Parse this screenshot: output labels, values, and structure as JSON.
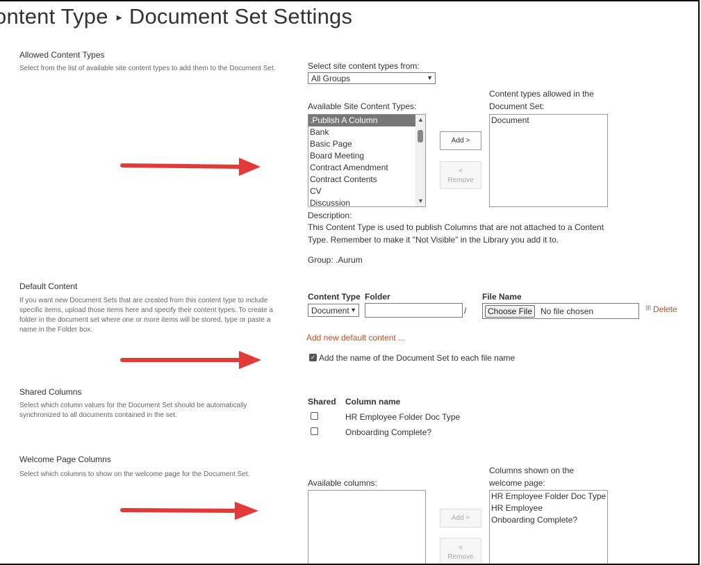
{
  "page": {
    "title_prefix": "ontent Type",
    "title_separator": "▸",
    "title_main": "Document Set Settings"
  },
  "allowed_content_types": {
    "heading": "Allowed Content Types",
    "description": "Select from the list of available site content types to add them to the Document Set.",
    "select_from_label": "Select site content types from:",
    "select_from_value": "All Groups",
    "available_label": "Available Site Content Types:",
    "available_items": [
      ".Publish A Column",
      "Bank",
      "Basic Page",
      "Board Meeting",
      "Contract Amendment",
      "Contract Contents",
      "CV",
      "Discussion"
    ],
    "selected_item": ".Publish A Column",
    "add_button": "Add >",
    "remove_button_top": "<",
    "remove_button_bottom": "Remove",
    "allowed_label": "Content types allowed in the Document Set:",
    "allowed_items": [
      "Document"
    ],
    "description_label": "Description:",
    "description_text": "This Content Type is used to publish Columns that are not attached to a Content Type. Remember to make it \"Not Visible\" in the Library you add it to.",
    "group_text": "Group: .Aurum"
  },
  "default_content": {
    "heading": "Default Content",
    "description": "If you want new Document Sets that are created from this content type to include specific items, upload those items here and specify their content types. To create a folder in the document set where one or more items will be stored, type or paste a name in the Folder box.",
    "col_content_type": "Content Type",
    "col_folder": "Folder",
    "col_file_name": "File Name",
    "content_type_value": "Document",
    "folder_value": "",
    "folder_slash": "/",
    "choose_file_button": "Choose File",
    "no_file_text": "No file chosen",
    "delete_icon": "⊞",
    "delete_link": "Delete",
    "add_new_link": "Add new default content ...",
    "add_name_checkbox_label": "Add the name of the Document Set to each file name",
    "add_name_checked": true
  },
  "shared_columns": {
    "heading": "Shared Columns",
    "description": "Select which column values for the Document Set should be automatically synchronized to all documents contained in the set.",
    "col_shared": "Shared",
    "col_name": "Column name",
    "rows": [
      {
        "name": "HR Employee Folder Doc Type",
        "checked": false
      },
      {
        "name": "Onboarding Complete?",
        "checked": false
      }
    ]
  },
  "welcome_page_columns": {
    "heading": "Welcome Page Columns",
    "description": "Select which columns to show on the welcome page for the Document Set.",
    "available_label": "Available columns:",
    "available_items": [],
    "add_button": "Add >",
    "remove_button_top": "<",
    "remove_button_bottom": "Remove",
    "shown_label": "Columns shown on the welcome page:",
    "shown_items": [
      "HR Employee Folder Doc Type",
      "HR Employee",
      "Onboarding Complete?"
    ]
  },
  "colors": {
    "annotation_arrow": "#e03a3a",
    "link": "#b4532a",
    "selected_option_bg": "#777777"
  }
}
